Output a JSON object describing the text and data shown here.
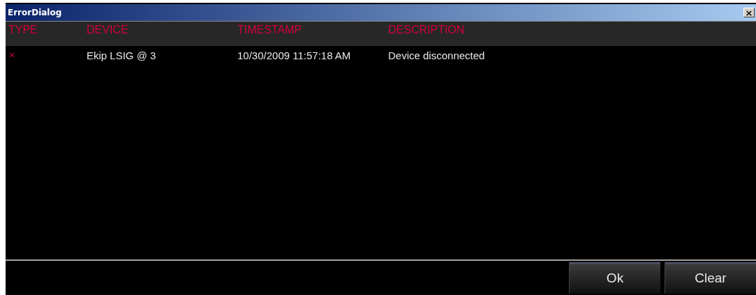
{
  "window": {
    "title": "ErrorDialog",
    "close": "×"
  },
  "table": {
    "columns": [
      "TYPE",
      "DEVICE",
      "TIMESTAMP",
      "DESCRIPTION"
    ],
    "rows": [
      {
        "type": "×",
        "device": "Ekip LSIG @ 3",
        "timestamp": "10/30/2009 11:57:18 AM",
        "description": "Device disconnected"
      }
    ]
  },
  "buttons": [
    "Ok",
    "Clear"
  ]
}
